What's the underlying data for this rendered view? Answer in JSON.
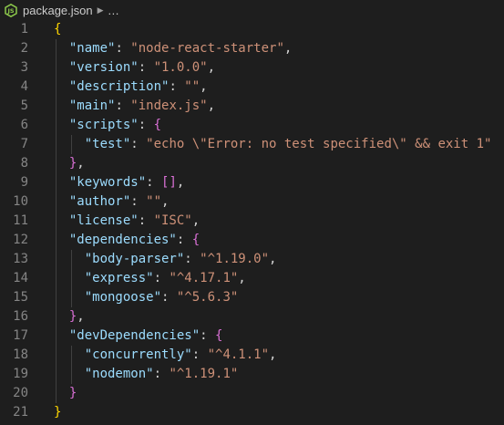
{
  "breadcrumb": {
    "file_icon": "nodejs-file-icon",
    "file_name": "package.json",
    "separator_icon": "chevron-right-icon",
    "ellipsis": "..."
  },
  "lines": [
    {
      "n": "1",
      "depth": 0,
      "tokens": [
        [
          "{",
          "b1"
        ]
      ]
    },
    {
      "n": "2",
      "depth": 1,
      "tokens": [
        [
          "\"name\"",
          "k"
        ],
        [
          ": ",
          "p"
        ],
        [
          "\"node-react-starter\"",
          "s"
        ],
        [
          ",",
          "p"
        ]
      ]
    },
    {
      "n": "3",
      "depth": 1,
      "tokens": [
        [
          "\"version\"",
          "k"
        ],
        [
          ": ",
          "p"
        ],
        [
          "\"1.0.0\"",
          "s"
        ],
        [
          ",",
          "p"
        ]
      ]
    },
    {
      "n": "4",
      "depth": 1,
      "tokens": [
        [
          "\"description\"",
          "k"
        ],
        [
          ": ",
          "p"
        ],
        [
          "\"\"",
          "s"
        ],
        [
          ",",
          "p"
        ]
      ]
    },
    {
      "n": "5",
      "depth": 1,
      "tokens": [
        [
          "\"main\"",
          "k"
        ],
        [
          ": ",
          "p"
        ],
        [
          "\"index.js\"",
          "s"
        ],
        [
          ",",
          "p"
        ]
      ]
    },
    {
      "n": "6",
      "depth": 1,
      "tokens": [
        [
          "\"scripts\"",
          "k"
        ],
        [
          ": ",
          "p"
        ],
        [
          "{",
          "b2"
        ]
      ]
    },
    {
      "n": "7",
      "depth": 2,
      "tokens": [
        [
          "\"test\"",
          "k"
        ],
        [
          ": ",
          "p"
        ],
        [
          "\"echo \\\"Error: no test specified\\\" && exit 1\"",
          "s"
        ]
      ]
    },
    {
      "n": "8",
      "depth": 1,
      "tokens": [
        [
          "}",
          "b2"
        ],
        [
          ",",
          "p"
        ]
      ]
    },
    {
      "n": "9",
      "depth": 1,
      "tokens": [
        [
          "\"keywords\"",
          "k"
        ],
        [
          ": ",
          "p"
        ],
        [
          "[",
          "b2"
        ],
        [
          "]",
          "b2"
        ],
        [
          ",",
          "p"
        ]
      ]
    },
    {
      "n": "10",
      "depth": 1,
      "tokens": [
        [
          "\"author\"",
          "k"
        ],
        [
          ": ",
          "p"
        ],
        [
          "\"\"",
          "s"
        ],
        [
          ",",
          "p"
        ]
      ]
    },
    {
      "n": "11",
      "depth": 1,
      "tokens": [
        [
          "\"license\"",
          "k"
        ],
        [
          ": ",
          "p"
        ],
        [
          "\"ISC\"",
          "s"
        ],
        [
          ",",
          "p"
        ]
      ]
    },
    {
      "n": "12",
      "depth": 1,
      "tokens": [
        [
          "\"dependencies\"",
          "k"
        ],
        [
          ": ",
          "p"
        ],
        [
          "{",
          "b2"
        ]
      ]
    },
    {
      "n": "13",
      "depth": 2,
      "tokens": [
        [
          "\"body-parser\"",
          "k"
        ],
        [
          ": ",
          "p"
        ],
        [
          "\"^1.19.0\"",
          "s"
        ],
        [
          ",",
          "p"
        ]
      ]
    },
    {
      "n": "14",
      "depth": 2,
      "tokens": [
        [
          "\"express\"",
          "k"
        ],
        [
          ": ",
          "p"
        ],
        [
          "\"^4.17.1\"",
          "s"
        ],
        [
          ",",
          "p"
        ]
      ]
    },
    {
      "n": "15",
      "depth": 2,
      "tokens": [
        [
          "\"mongoose\"",
          "k"
        ],
        [
          ": ",
          "p"
        ],
        [
          "\"^5.6.3\"",
          "s"
        ]
      ]
    },
    {
      "n": "16",
      "depth": 1,
      "tokens": [
        [
          "}",
          "b2"
        ],
        [
          ",",
          "p"
        ]
      ]
    },
    {
      "n": "17",
      "depth": 1,
      "tokens": [
        [
          "\"devDependencies\"",
          "k"
        ],
        [
          ": ",
          "p"
        ],
        [
          "{",
          "b2"
        ]
      ]
    },
    {
      "n": "18",
      "depth": 2,
      "tokens": [
        [
          "\"concurrently\"",
          "k"
        ],
        [
          ": ",
          "p"
        ],
        [
          "\"^4.1.1\"",
          "s"
        ],
        [
          ",",
          "p"
        ]
      ]
    },
    {
      "n": "19",
      "depth": 2,
      "tokens": [
        [
          "\"nodemon\"",
          "k"
        ],
        [
          ": ",
          "p"
        ],
        [
          "\"^1.19.1\"",
          "s"
        ]
      ]
    },
    {
      "n": "20",
      "depth": 1,
      "tokens": [
        [
          "}",
          "b2"
        ]
      ]
    },
    {
      "n": "21",
      "depth": 0,
      "tokens": [
        [
          "}",
          "b1"
        ]
      ]
    }
  ],
  "colors": {
    "background": "#1e1e1e",
    "line_number": "#858585",
    "key": "#9cdcfe",
    "string": "#ce9178",
    "punctuation": "#d4d4d4",
    "bracket_level_1": "#ffd700",
    "bracket_level_2": "#da70d6",
    "nodejs_icon": "#8cc84b"
  }
}
